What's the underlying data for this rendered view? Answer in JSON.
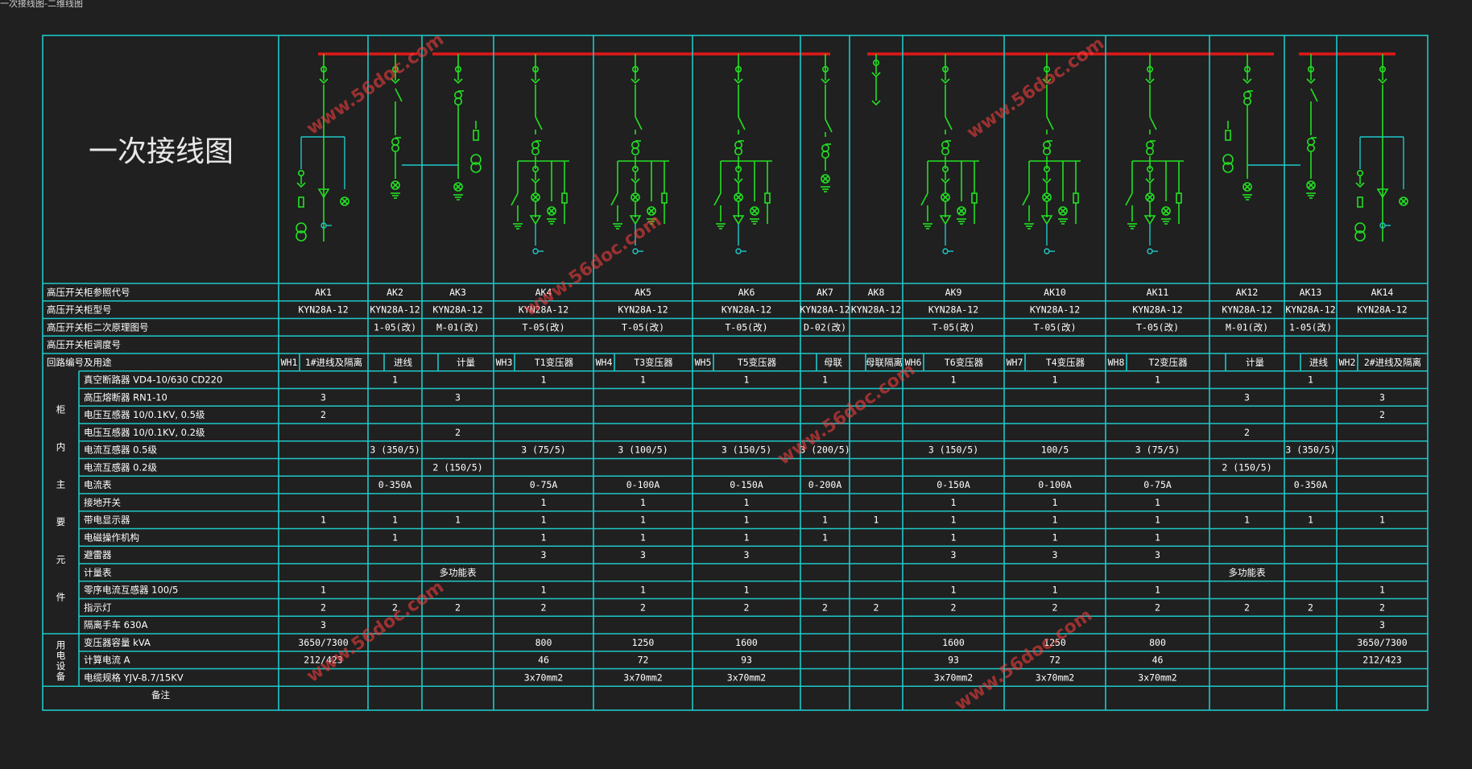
{
  "window_caption": "一次接线图-二维线图",
  "diagram_title": "一次接线图",
  "watermark_text": "www.56doc.com",
  "colors": {
    "background": "#202020",
    "grid": "#1ec8c8",
    "busbar": "#e01818",
    "symbol": "#22e022",
    "text": "#ffffff"
  },
  "side_labels": {
    "cabinet_components": "柜内主要元件",
    "load_equipment": "用电设备"
  },
  "rows": [
    {
      "label": "高压开关柜参照代号",
      "cells": [
        "AK1",
        "AK2",
        "AK3",
        "AK4",
        "AK5",
        "AK6",
        "AK7",
        "AK8",
        "AK9",
        "AK10",
        "AK11",
        "AK12",
        "AK13",
        "AK14"
      ]
    },
    {
      "label": "高压开关柜型号",
      "cells": [
        "KYN28A-12",
        "KYN28A-12",
        "KYN28A-12",
        "KYN28A-12",
        "KYN28A-12",
        "KYN28A-12",
        "KYN28A-12",
        "KYN28A-12",
        "KYN28A-12",
        "KYN28A-12",
        "KYN28A-12",
        "KYN28A-12",
        "KYN28A-12",
        "KYN28A-12"
      ]
    },
    {
      "label": "高压开关柜二次原理图号",
      "cells": [
        "",
        "1-05(改)",
        "M-01(改)",
        "T-05(改)",
        "T-05(改)",
        "T-05(改)",
        "D-02(改)",
        "",
        "T-05(改)",
        "T-05(改)",
        "T-05(改)",
        "M-01(改)",
        "1-05(改)",
        ""
      ]
    },
    {
      "label": "高压开关柜调度号",
      "cells": [
        "",
        "",
        "",
        "",
        "",
        "",
        "",
        "",
        "",
        "",
        "",
        "",
        "",
        ""
      ]
    },
    {
      "label": "回路编号及用途",
      "cells": [
        "1#进线及隔离",
        "进线",
        "计量",
        "T1变压器",
        "T3变压器",
        "T5变压器",
        "母联",
        "母联隔离",
        "T6变压器",
        "T4变压器",
        "T2变压器",
        "计量",
        "进线",
        "2#进线及隔离"
      ],
      "circuit_codes": [
        "WH1",
        "",
        "",
        "WH3",
        "WH4",
        "WH5",
        "",
        "",
        "WH6",
        "WH7",
        "WH8",
        "",
        "",
        "WH2"
      ]
    },
    {
      "label": "真空断路器 VD4-10/630 CD220",
      "cells": [
        "",
        "1",
        "",
        "1",
        "1",
        "1",
        "1",
        "",
        "1",
        "1",
        "1",
        "",
        "1",
        ""
      ]
    },
    {
      "label": "高压熔断器 RN1-10",
      "cells": [
        "3",
        "",
        "3",
        "",
        "",
        "",
        "",
        "",
        "",
        "",
        "",
        "3",
        "",
        "3"
      ]
    },
    {
      "label": "电压互感器 10/0.1KV, 0.5级",
      "cells": [
        "2",
        "",
        "",
        "",
        "",
        "",
        "",
        "",
        "",
        "",
        "",
        "",
        "",
        "2"
      ]
    },
    {
      "label": "电压互感器 10/0.1KV, 0.2级",
      "cells": [
        "",
        "",
        "2",
        "",
        "",
        "",
        "",
        "",
        "",
        "",
        "",
        "2",
        "",
        ""
      ]
    },
    {
      "label": "电流互感器 0.5级",
      "cells": [
        "",
        "3 (350/5)",
        "",
        "3 (75/5)",
        "3 (100/5)",
        "3 (150/5)",
        "3 (200/5)",
        "",
        "3 (150/5)",
        "100/5",
        "3 (75/5)",
        "",
        "3 (350/5)",
        ""
      ]
    },
    {
      "label": "电流互感器 0.2级",
      "cells": [
        "",
        "",
        "2 (150/5)",
        "",
        "",
        "",
        "",
        "",
        "",
        "",
        "",
        "2 (150/5)",
        "",
        ""
      ]
    },
    {
      "label": "电流表",
      "cells": [
        "",
        "0-350A",
        "",
        "0-75A",
        "0-100A",
        "0-150A",
        "0-200A",
        "",
        "0-150A",
        "0-100A",
        "0-75A",
        "",
        "0-350A",
        ""
      ]
    },
    {
      "label": "接地开关",
      "cells": [
        "",
        "",
        "",
        "1",
        "1",
        "1",
        "",
        "",
        "1",
        "1",
        "1",
        "",
        "",
        ""
      ]
    },
    {
      "label": "带电显示器",
      "cells": [
        "1",
        "1",
        "1",
        "1",
        "1",
        "1",
        "1",
        "1",
        "1",
        "1",
        "1",
        "1",
        "1",
        "1"
      ]
    },
    {
      "label": "电磁操作机构",
      "cells": [
        "",
        "1",
        "",
        "1",
        "1",
        "1",
        "1",
        "",
        "1",
        "1",
        "1",
        "",
        "",
        ""
      ]
    },
    {
      "label": "避雷器",
      "cells": [
        "",
        "",
        "",
        "3",
        "3",
        "3",
        "",
        "",
        "3",
        "3",
        "3",
        "",
        "",
        ""
      ]
    },
    {
      "label": "计量表",
      "cells": [
        "",
        "",
        "多功能表",
        "",
        "",
        "",
        "",
        "",
        "",
        "",
        "",
        "多功能表",
        "",
        ""
      ]
    },
    {
      "label": "零序电流互感器 100/5",
      "cells": [
        "1",
        "",
        "",
        "1",
        "1",
        "1",
        "",
        "",
        "1",
        "1",
        "1",
        "",
        "",
        "1"
      ]
    },
    {
      "label": "指示灯",
      "cells": [
        "2",
        "2",
        "2",
        "2",
        "2",
        "2",
        "2",
        "2",
        "2",
        "2",
        "2",
        "2",
        "2",
        "2"
      ]
    },
    {
      "label": "隔离手车 630A",
      "cells": [
        "3",
        "",
        "",
        "",
        "",
        "",
        "",
        "",
        "",
        "",
        "",
        "",
        "",
        "3"
      ]
    },
    {
      "label": "变压器容量 kVA",
      "cells": [
        "3650/7300",
        "",
        "",
        "800",
        "1250",
        "1600",
        "",
        "",
        "1600",
        "1250",
        "800",
        "",
        "",
        "3650/7300"
      ]
    },
    {
      "label": "计算电流 A",
      "cells": [
        "212/423",
        "",
        "",
        "46",
        "72",
        "93",
        "",
        "",
        "93",
        "72",
        "46",
        "",
        "",
        "212/423"
      ]
    },
    {
      "label": "电缆规格 YJV-8.7/15KV",
      "cells": [
        "",
        "",
        "",
        "3x70mm2",
        "3x70mm2",
        "3x70mm2",
        "",
        "",
        "3x70mm2",
        "3x70mm2",
        "3x70mm2",
        "",
        "",
        ""
      ]
    },
    {
      "label": "备注",
      "cells": [
        "",
        "",
        "",
        "",
        "",
        "",
        "",
        "",
        "",
        "",
        "",
        "",
        "",
        ""
      ]
    }
  ],
  "column_types": [
    "incoming-pt",
    "incoming",
    "metering",
    "transformer",
    "transformer",
    "transformer",
    "tie",
    "tie-isolator",
    "transformer",
    "transformer",
    "transformer",
    "metering",
    "incoming",
    "incoming-pt"
  ]
}
